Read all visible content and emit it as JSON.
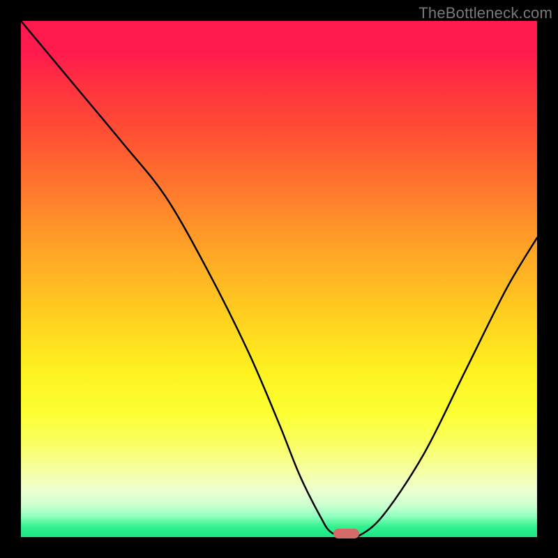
{
  "watermark": "TheBottleneck.com",
  "chart_data": {
    "type": "line",
    "title": "",
    "xlabel": "",
    "ylabel": "",
    "xlim": [
      0,
      100
    ],
    "ylim": [
      0,
      100
    ],
    "grid": false,
    "series": [
      {
        "name": "curve",
        "color": "#000000",
        "x": [
          0,
          10,
          20,
          28,
          36,
          44,
          50,
          54,
          58,
          60,
          63,
          65,
          70,
          78,
          86,
          94,
          100
        ],
        "y": [
          100,
          88,
          76,
          66,
          52,
          36,
          22,
          12,
          4,
          1,
          0,
          0,
          4,
          16,
          32,
          48,
          58
        ]
      }
    ],
    "marker": {
      "x_start": 60.5,
      "x_end": 65.5,
      "y": 0,
      "color": "#d46a6a"
    },
    "background_gradient": {
      "type": "vertical",
      "stops": [
        {
          "pos": 0.0,
          "color": "#ff1a4d"
        },
        {
          "pos": 0.5,
          "color": "#ffb020"
        },
        {
          "pos": 0.78,
          "color": "#fcff4a"
        },
        {
          "pos": 1.0,
          "color": "#1ae884"
        }
      ]
    }
  }
}
